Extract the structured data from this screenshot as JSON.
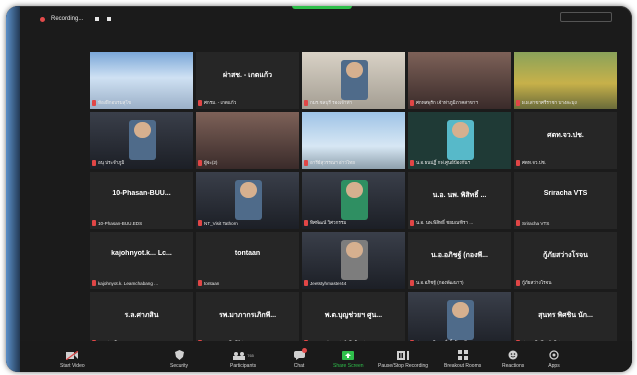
{
  "topbar": {
    "recording_label": "Recording..."
  },
  "tiles": [
    {
      "caption": "ห้องฝึกอบรมสุโข",
      "kind": "video"
    },
    {
      "center": "ผ่าสช. - เกตแก้ว",
      "caption": "ศกรม. - เกตแก้ว",
      "kind": "name"
    },
    {
      "caption": "กมร.ชลบุรี รองเจ้าท่า",
      "kind": "video"
    },
    {
      "caption": "ศกทสพุรัก เจ้าท่าภูมิภาคสาขาฯ",
      "kind": "video"
    },
    {
      "caption": "ผ.ผ.สาขาศรีราชา บางละมุง",
      "kind": "video"
    },
    {
      "caption": "อนุ ประจำภูมิ",
      "kind": "video"
    },
    {
      "caption": "ผู้จะ(2)",
      "kind": "video"
    },
    {
      "caption": "อารีย์สุวรรณฯ อ่าวไทย",
      "kind": "video"
    },
    {
      "caption": "น.อ.ธนปฏิ์ กฟ.ศูนย์ป้องกันฯ",
      "kind": "video"
    },
    {
      "center": "ศตท.จว.ปช.",
      "caption": "ศตท.จว.ปช.",
      "kind": "name"
    },
    {
      "center": "10-Phasan-BUU...",
      "caption": "10-Phasan-BUU.EDS",
      "kind": "name"
    },
    {
      "caption": "NT_Visit Tathorn",
      "kind": "video"
    },
    {
      "caption": "ทิศพัฒน์ วิศวกรรม",
      "kind": "video"
    },
    {
      "center": "น.อ. นพ. พิสิทธิ์ ...",
      "caption": "น.อ. นพ.พิสิทธิ์ ชยมณฑิรา ...",
      "kind": "name"
    },
    {
      "center": "Sriracha VTS",
      "caption": "Sriracha VTS",
      "kind": "name"
    },
    {
      "center": "kajohnyot.k... Lc...",
      "caption": "kajohnyot.k. Leamchabang ...",
      "kind": "name"
    },
    {
      "center": "tontaan",
      "caption": "tontaan",
      "kind": "name"
    },
    {
      "caption": "Jeetstyhmaster44",
      "kind": "video"
    },
    {
      "center": "น.อ.อภิชฐ์ (กองพี...",
      "caption": "น.อ.อภิชฐ์ (กองพัฒนาฯ)",
      "kind": "name"
    },
    {
      "center": "กู้ภัยสว่างโรจน",
      "caption": "กู้ภัยสว่างโรจน",
      "kind": "name"
    },
    {
      "center": "ร.ล.ศาภสิน",
      "caption": "ร.ล.ศาภสิน",
      "kind": "name"
    },
    {
      "center": "รพ.มาภากรเภิกพี...",
      "caption": "รพ.มาภากรเภิกพีร์ศุลกร",
      "kind": "name"
    },
    {
      "center": "พ.ต.บุญช่วยฯ ศูน...",
      "caption": "พ.ต.บุญช่วยฯ ศูนย์กรีนวิน ชบ.",
      "kind": "name"
    },
    {
      "caption": "ศกรม. ภูมิภาคที่ ชั้นโมนที",
      "kind": "video"
    },
    {
      "center": "สุนทร พิศชิน นัก...",
      "caption": "สุนทร พิศชิน นักวิชาการฯ",
      "kind": "name"
    }
  ],
  "toolbar": {
    "start_video": "Start Video",
    "security": "Security",
    "participants": "Participants",
    "participants_count": "765",
    "chat": "Chat",
    "share_screen": "Share Screen",
    "pause_stop": "Pause/Stop Recording",
    "breakout": "Breakout Rooms",
    "reactions": "Reactions",
    "apps": "Apps"
  },
  "colors": {
    "share_green": "#2fbf4b",
    "mute_red": "#e04646"
  }
}
